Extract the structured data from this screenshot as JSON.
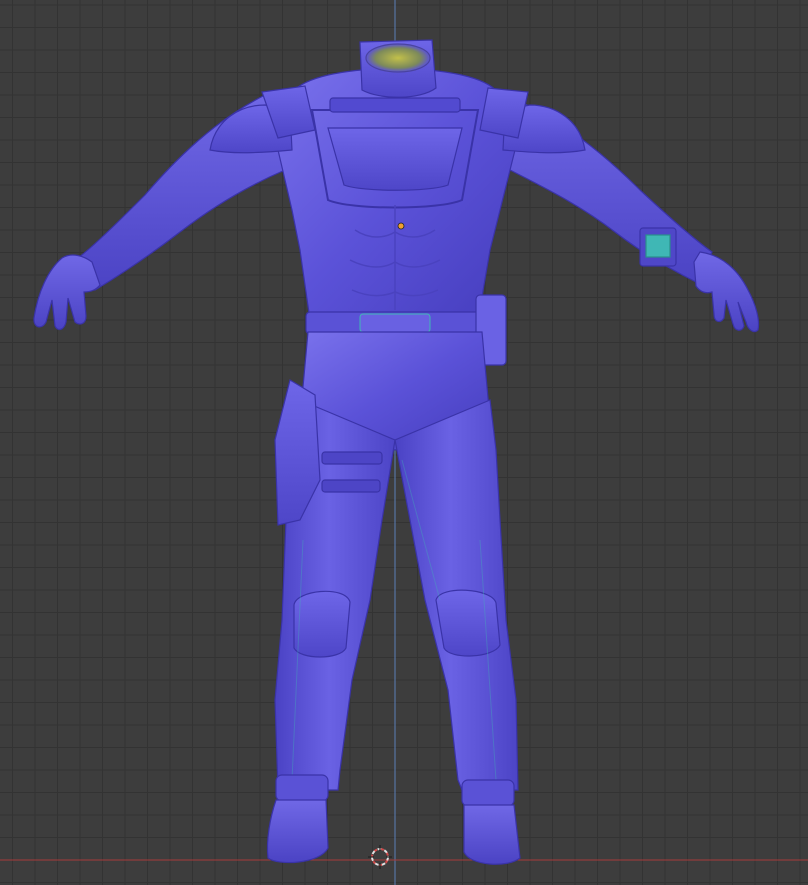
{
  "viewport": {
    "kind": "3d-viewport",
    "view": "front-orthographic",
    "shading": "normal-map-matcap",
    "grid": true,
    "object": "character-suit-mesh"
  },
  "colors": {
    "background": "#3d3d3d",
    "grid_minor": "#333333",
    "grid_major": "#2e2e2e",
    "axis_z": "#5b7fb8",
    "axis_x": "#a83a3a",
    "mesh_base": "#5b52d8",
    "mesh_light": "#7c74ee",
    "mesh_dark": "#3f37b0",
    "accent_teal": "#3fb7b5",
    "accent_yellow": "#b8b040",
    "cursor_ring": "#e0e0e0",
    "cursor_dash": "#d04a4a",
    "origin_dot": "#f0a030"
  },
  "icons": {
    "cursor": "3d-cursor-icon",
    "origin": "origin-point-icon"
  }
}
